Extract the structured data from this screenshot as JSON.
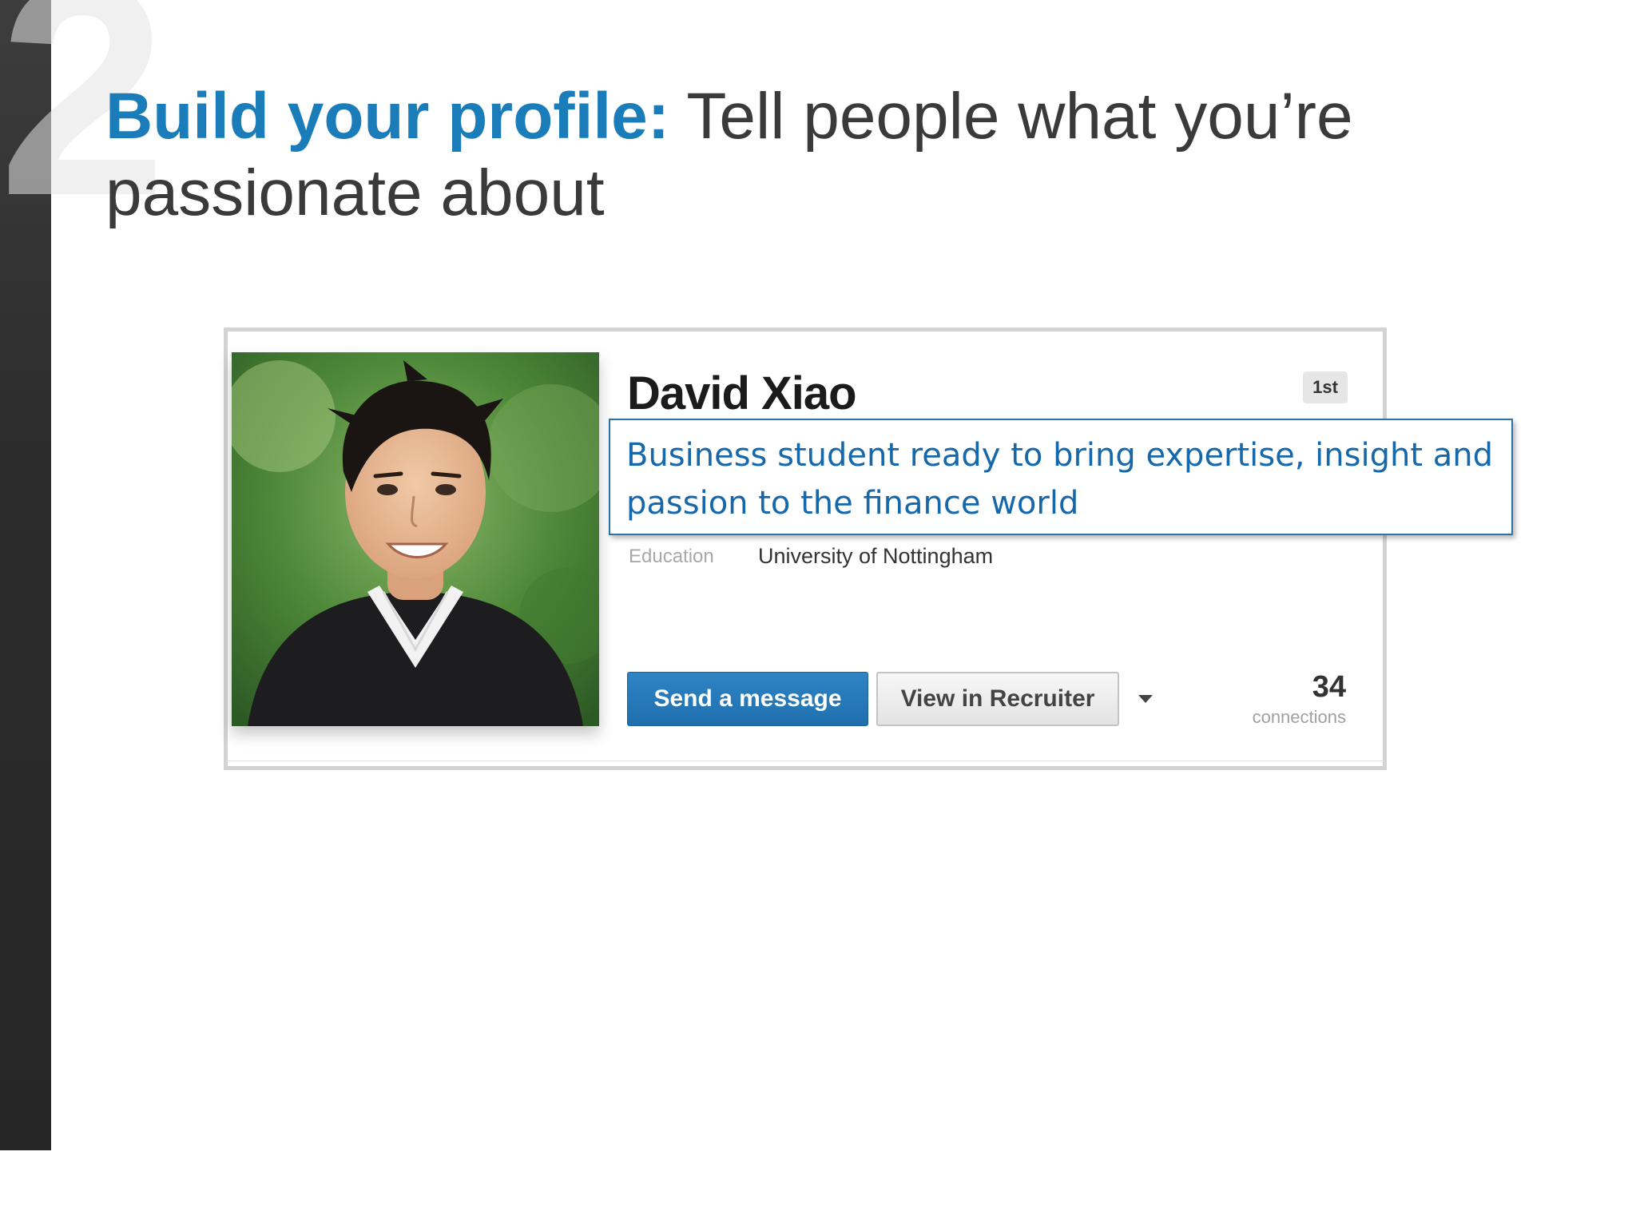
{
  "slide": {
    "step_number": "2",
    "title_accent": "Build your profile:",
    "title_rest": " Tell people what you’re passionate about"
  },
  "profile": {
    "name": "David Xiao",
    "connection_degree": "1st",
    "education_label": "Education",
    "education_value": "University of Nottingham",
    "send_message_label": "Send a message",
    "view_recruiter_label": "View in Recruiter",
    "connections_count": "34",
    "connections_label": "connections"
  },
  "callout": {
    "headline": "Business student ready to bring expertise, insight and passion to the finance world"
  },
  "colors": {
    "accent_blue": "#1a7cb8",
    "button_blue": "#1f6fae",
    "callout_text": "#1668aa",
    "sidebar_dark": "#2c2c2c"
  }
}
